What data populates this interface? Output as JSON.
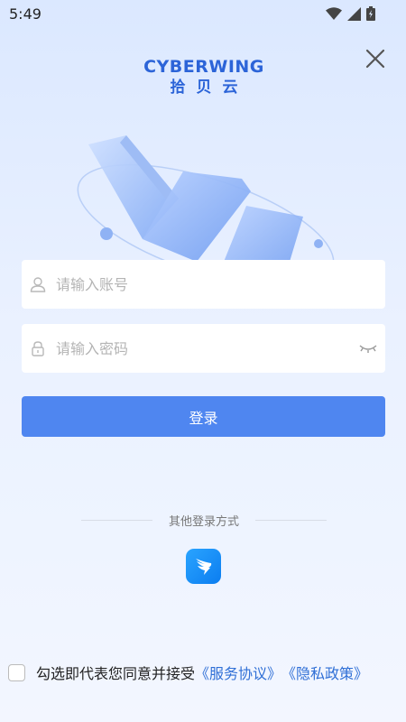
{
  "status_bar": {
    "time": "5:49"
  },
  "logo": {
    "en": "CYBERWING",
    "cn": "拾贝云"
  },
  "form": {
    "account_placeholder": "请输入账号",
    "password_placeholder": "请输入密码",
    "login_label": "登录"
  },
  "other_login": {
    "label": "其他登录方式"
  },
  "agreement": {
    "prefix": "勾选即代表您同意并接受",
    "service_link": "《服务协议》",
    "privacy_link": "《隐私政策》"
  },
  "colors": {
    "primary": "#4f86f0",
    "link": "#2f6fd6",
    "brand": "#2c64d8"
  },
  "icons": {
    "close": "close-icon",
    "user": "user-icon",
    "lock": "lock-icon",
    "eye": "eye-closed-icon",
    "dingtalk": "dingtalk-icon"
  }
}
